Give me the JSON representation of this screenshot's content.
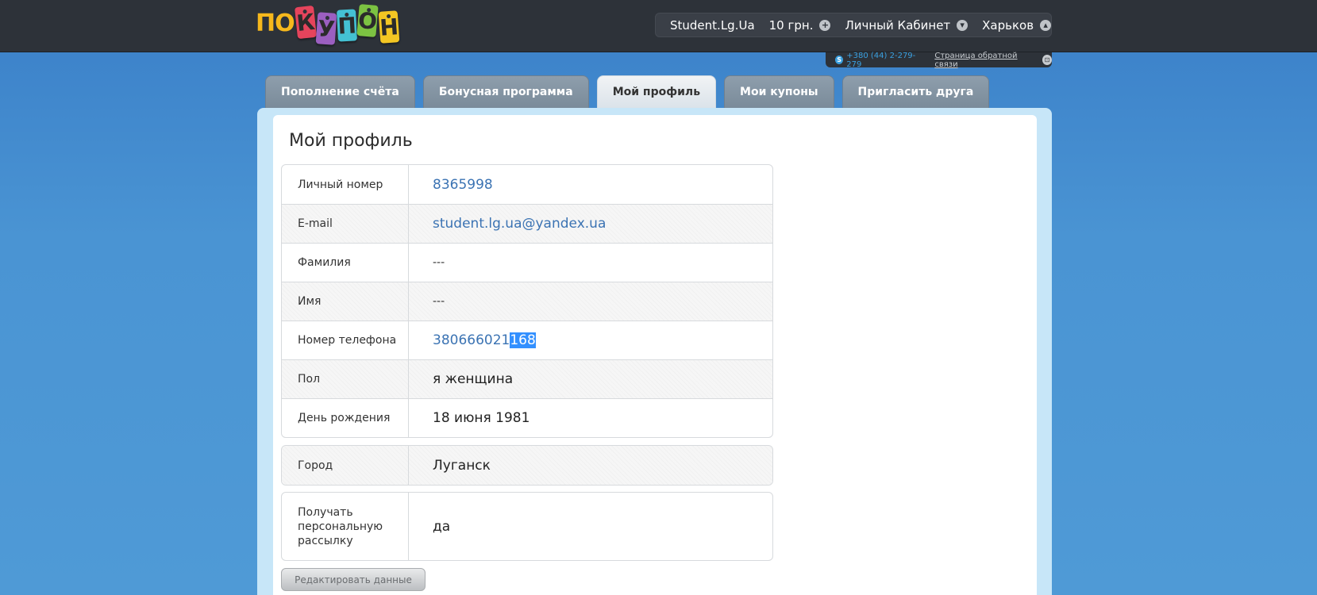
{
  "header": {
    "logo": {
      "prefix": "ПО",
      "letters": [
        "К",
        "У",
        "П",
        "О",
        "Н"
      ]
    },
    "user": {
      "username": "Student.Lg.Ua",
      "balance": "10 грн.",
      "cabinet": "Личный Кабинет",
      "city": "Харьков"
    },
    "contact": {
      "phone": "+380 (44) 2-279-279",
      "feedback": "Страница обратной связи"
    }
  },
  "tabs": [
    {
      "label": "Пополнение счёта",
      "active": false
    },
    {
      "label": "Бонусная программа",
      "active": false
    },
    {
      "label": "Мой профиль",
      "active": true
    },
    {
      "label": "Мои купоны",
      "active": false
    },
    {
      "label": "Пригласить друга",
      "active": false
    }
  ],
  "profile": {
    "title": "Мой профиль",
    "fields": [
      {
        "label": "Личный номер",
        "value": "8365998"
      },
      {
        "label": "E-mail",
        "value": "student.lg.ua@yandex.ua"
      },
      {
        "label": "Фамилия",
        "value": "---"
      },
      {
        "label": "Имя",
        "value": "---"
      },
      {
        "label": "Номер телефона",
        "value": "380666021",
        "value_selected": "168"
      },
      {
        "label": "Пол",
        "value": "я женщина"
      },
      {
        "label": "День рождения",
        "value": "18 июня 1981"
      }
    ],
    "city": {
      "label": "Город",
      "value": "Луганск"
    },
    "newsletter": {
      "label": "Получать персональную рассылку",
      "value": "да"
    },
    "edit_label": "Редактировать данные"
  },
  "colors": {
    "topbar": "#2d3239",
    "background": "#4a94d3",
    "link": "#3b73b3",
    "selection": "#3390ff"
  }
}
